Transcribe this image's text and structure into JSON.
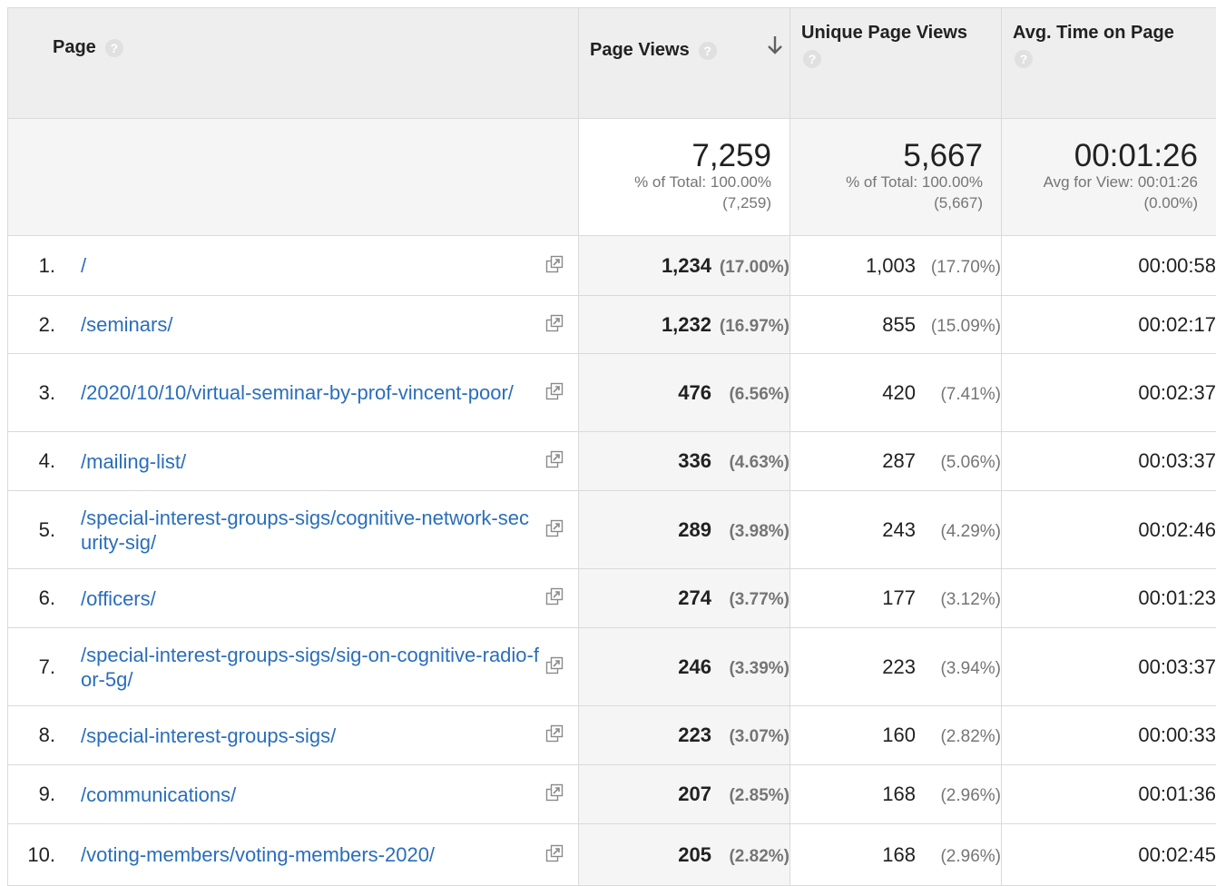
{
  "header": {
    "page": "Page",
    "page_views": "Page Views",
    "unique_page_views": "Unique Page Views",
    "avg_time": "Avg. Time on Page",
    "help_glyph": "?"
  },
  "totals": {
    "page_views": {
      "value": "7,259",
      "line1": "% of Total: 100.00%",
      "line2": "(7,259)"
    },
    "unique_page_views": {
      "value": "5,667",
      "line1": "% of Total: 100.00%",
      "line2": "(5,667)"
    },
    "avg_time": {
      "value": "00:01:26",
      "line1": "Avg for View: 00:01:26",
      "line2": "(0.00%)"
    }
  },
  "rows": [
    {
      "rank": "1.",
      "page": "/",
      "pv": "1,234",
      "pv_pct": "(17.00%)",
      "upv": "1,003",
      "upv_pct": "(17.70%)",
      "avg": "00:00:58"
    },
    {
      "rank": "2.",
      "page": "/seminars/",
      "pv": "1,232",
      "pv_pct": "(16.97%)",
      "upv": "855",
      "upv_pct": "(15.09%)",
      "avg": "00:02:17"
    },
    {
      "rank": "3.",
      "page": "/2020/10/10/virtual-seminar-by-prof-vincent-poor/",
      "pv": "476",
      "pv_pct": "(6.56%)",
      "upv": "420",
      "upv_pct": "(7.41%)",
      "avg": "00:02:37"
    },
    {
      "rank": "4.",
      "page": "/mailing-list/",
      "pv": "336",
      "pv_pct": "(4.63%)",
      "upv": "287",
      "upv_pct": "(5.06%)",
      "avg": "00:03:37"
    },
    {
      "rank": "5.",
      "page": "/special-interest-groups-sigs/cognitive-network-security-sig/",
      "pv": "289",
      "pv_pct": "(3.98%)",
      "upv": "243",
      "upv_pct": "(4.29%)",
      "avg": "00:02:46"
    },
    {
      "rank": "6.",
      "page": "/officers/",
      "pv": "274",
      "pv_pct": "(3.77%)",
      "upv": "177",
      "upv_pct": "(3.12%)",
      "avg": "00:01:23"
    },
    {
      "rank": "7.",
      "page": "/special-interest-groups-sigs/sig-on-cognitive-radio-for-5g/",
      "pv": "246",
      "pv_pct": "(3.39%)",
      "upv": "223",
      "upv_pct": "(3.94%)",
      "avg": "00:03:37"
    },
    {
      "rank": "8.",
      "page": "/special-interest-groups-sigs/",
      "pv": "223",
      "pv_pct": "(3.07%)",
      "upv": "160",
      "upv_pct": "(2.82%)",
      "avg": "00:00:33"
    },
    {
      "rank": "9.",
      "page": "/communications/",
      "pv": "207",
      "pv_pct": "(2.85%)",
      "upv": "168",
      "upv_pct": "(2.96%)",
      "avg": "00:01:36"
    },
    {
      "rank": "10.",
      "page": "/voting-members/voting-members-2020/",
      "pv": "205",
      "pv_pct": "(2.82%)",
      "upv": "168",
      "upv_pct": "(2.96%)",
      "avg": "00:02:45"
    }
  ],
  "colors": {
    "link": "#2a6ebb",
    "header_bg": "#eeeeee",
    "muted": "#757575",
    "border": "#dadada"
  },
  "icons": {
    "help": "question-circle-icon",
    "sort": "arrow-down-icon",
    "open_page": "external-link-icon"
  }
}
